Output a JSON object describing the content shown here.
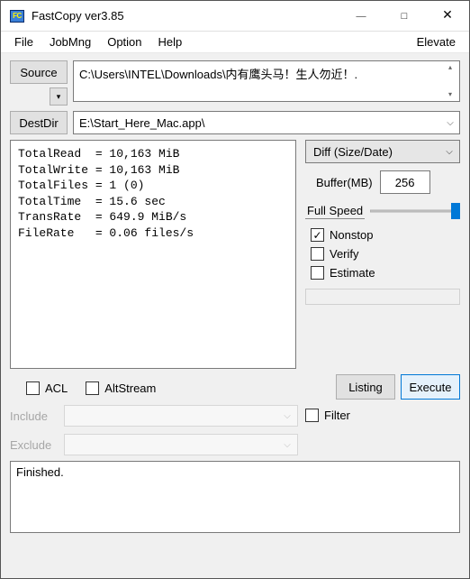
{
  "title": "FastCopy ver3.85",
  "menu": {
    "file": "File",
    "jobmng": "JobMng",
    "option": "Option",
    "help": "Help",
    "elevate": "Elevate"
  },
  "source": {
    "button": "Source",
    "value": "C:\\Users\\INTEL\\Downloads\\内有鹰头马！生人勿近！."
  },
  "dest": {
    "button": "DestDir",
    "value": "E:\\Start_Here_Mac.app\\"
  },
  "stats": "TotalRead  = 10,163 MiB\nTotalWrite = 10,163 MiB\nTotalFiles = 1 (0)\nTotalTime  = 15.6 sec\nTransRate  = 649.9 MiB/s\nFileRate   = 0.06 files/s",
  "mode": "Diff (Size/Date)",
  "buffer": {
    "label": "Buffer(MB)",
    "value": "256"
  },
  "speed": {
    "label": "Full Speed"
  },
  "checks": {
    "nonstop": "Nonstop",
    "verify": "Verify",
    "estimate": "Estimate"
  },
  "extra": {
    "acl": "ACL",
    "altstream": "AltStream"
  },
  "actions": {
    "listing": "Listing",
    "execute": "Execute"
  },
  "filterToggle": "Filter",
  "filters": {
    "include": "Include",
    "exclude": "Exclude"
  },
  "log": "Finished."
}
